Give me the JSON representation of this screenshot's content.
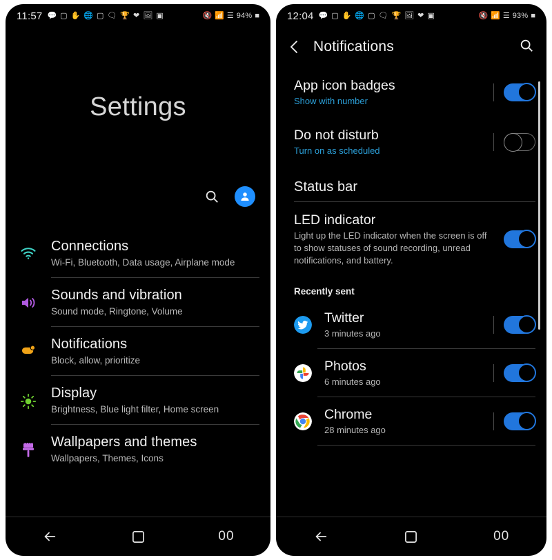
{
  "left_phone": {
    "status_bar": {
      "time": "11:57",
      "battery_text": "94%",
      "notification_icons": [
        "chat-bubble-icon",
        "instagram-icon",
        "hand-icon",
        "globe-icon",
        "instagram-icon",
        "speech-icon",
        "trophy-icon",
        "heart-icon",
        "photo-icon",
        "app-icon"
      ],
      "right_icons": [
        "mute-icon",
        "wifi-icon",
        "signal-icon"
      ]
    },
    "page_title": "Settings",
    "actions": {
      "search": "search-icon",
      "account": "account-avatar-icon"
    },
    "items": [
      {
        "title": "Connections",
        "subtitle": "Wi-Fi, Bluetooth, Data usage, Airplane mode",
        "icon": "wifi-icon",
        "icon_color": "#3fd3c6"
      },
      {
        "title": "Sounds and vibration",
        "subtitle": "Sound mode, Ringtone, Volume",
        "icon": "volume-icon",
        "icon_color": "#b05ae0"
      },
      {
        "title": "Notifications",
        "subtitle": "Block, allow, prioritize",
        "icon": "notification-badge-icon",
        "icon_color": "#f0a318"
      },
      {
        "title": "Display",
        "subtitle": "Brightness, Blue light filter, Home screen",
        "icon": "brightness-icon",
        "icon_color": "#6fd130"
      },
      {
        "title": "Wallpapers and themes",
        "subtitle": "Wallpapers, Themes, Icons",
        "icon": "paint-roller-icon",
        "icon_color": "#c46ae8"
      }
    ],
    "nav": {
      "back": "back-arrow-icon",
      "home": "home-square-icon",
      "recents": "00"
    }
  },
  "right_phone": {
    "status_bar": {
      "time": "12:04",
      "battery_text": "93%",
      "notification_icons": [
        "chat-bubble-icon",
        "instagram-icon",
        "hand-icon",
        "globe-icon",
        "instagram-icon",
        "speech-icon",
        "trophy-icon",
        "photo-icon",
        "heart-icon",
        "app-icon"
      ],
      "right_icons": [
        "mute-icon",
        "wifi-icon",
        "signal-icon"
      ]
    },
    "header": {
      "back": "back-chevron-icon",
      "title": "Notifications",
      "search": "search-icon"
    },
    "settings": [
      {
        "title": "App icon badges",
        "subtitle": "Show with number",
        "subtitle_style": "blue",
        "toggle": "on"
      },
      {
        "title": "Do not disturb",
        "subtitle": "Turn on as scheduled",
        "subtitle_style": "blue",
        "toggle": "off"
      }
    ],
    "status_bar_section": {
      "label": "Status bar"
    },
    "led": {
      "title": "LED indicator",
      "subtitle": "Light up the LED indicator when the screen is off to show statuses of sound recording, unread notifications, and battery.",
      "toggle": "on"
    },
    "recently_sent_label": "Recently sent",
    "apps": [
      {
        "name": "Twitter",
        "time": "3 minutes ago",
        "icon": "twitter-icon",
        "toggle": "on"
      },
      {
        "name": "Photos",
        "time": "6 minutes ago",
        "icon": "google-photos-icon",
        "toggle": "on"
      },
      {
        "name": "Chrome",
        "time": "28 minutes ago",
        "icon": "chrome-icon",
        "toggle": "on"
      }
    ],
    "nav": {
      "back": "back-arrow-icon",
      "home": "home-square-icon",
      "recents": "00"
    }
  },
  "colors": {
    "accent_blue": "#2176dd",
    "link_blue": "#2b9fd8",
    "background": "#000000",
    "page_background": "#ffffff"
  }
}
